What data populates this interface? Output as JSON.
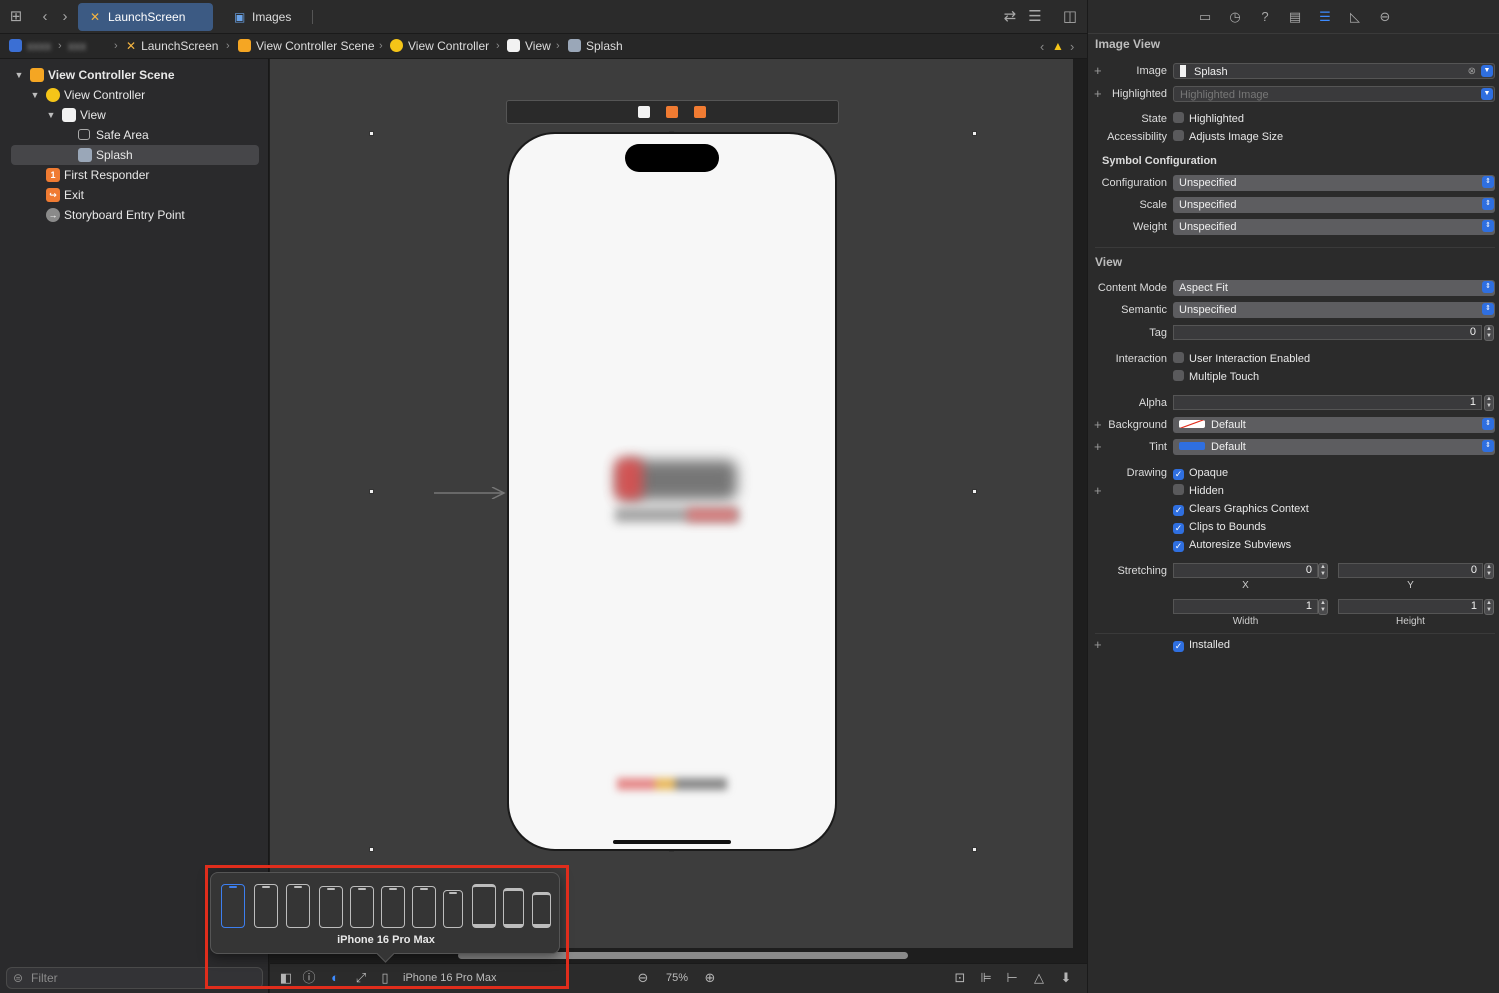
{
  "tabs": [
    {
      "label": "LaunchScreen",
      "active": true,
      "icon": "storyboard-icon"
    },
    {
      "label": "Images",
      "active": false,
      "icon": "asset-catalog-icon"
    }
  ],
  "breadcrumb": {
    "project": "xxxx",
    "group": "xxx",
    "file": "LaunchScreen",
    "scene": "View Controller Scene",
    "controller": "View Controller",
    "view": "View",
    "item": "Splash"
  },
  "navigator": {
    "items": [
      {
        "label": "View Controller Scene",
        "icon": "scene-icon"
      },
      {
        "label": "View Controller",
        "icon": "view-controller-icon"
      },
      {
        "label": "View",
        "icon": "view-icon"
      },
      {
        "label": "Safe Area",
        "icon": "safe-area-icon"
      },
      {
        "label": "Splash",
        "icon": "image-view-icon"
      },
      {
        "label": "First Responder",
        "icon": "first-responder-icon"
      },
      {
        "label": "Exit",
        "icon": "exit-icon"
      },
      {
        "label": "Storyboard Entry Point",
        "icon": "entry-point-icon"
      }
    ],
    "filter_placeholder": "Filter"
  },
  "bottombar": {
    "device": "iPhone 16 Pro Max",
    "zoom": "75%"
  },
  "device_popover": {
    "selected_device": "iPhone 16 Pro Max"
  },
  "inspector": {
    "image_view": {
      "title": "Image View",
      "image_label": "Image",
      "image_value": "Splash",
      "highlighted_label": "Highlighted",
      "highlighted_placeholder": "Highlighted Image",
      "state_label": "State",
      "state_option": "Highlighted",
      "accessibility_label": "Accessibility",
      "accessibility_option": "Adjusts Image Size",
      "symbol_title": "Symbol Configuration",
      "configuration_label": "Configuration",
      "configuration_value": "Unspecified",
      "scale_label": "Scale",
      "scale_value": "Unspecified",
      "weight_label": "Weight",
      "weight_value": "Unspecified"
    },
    "view": {
      "title": "View",
      "content_mode_label": "Content Mode",
      "content_mode_value": "Aspect Fit",
      "semantic_label": "Semantic",
      "semantic_value": "Unspecified",
      "tag_label": "Tag",
      "tag_value": "0",
      "interaction_label": "Interaction",
      "user_interaction": "User Interaction Enabled",
      "multiple_touch": "Multiple Touch",
      "alpha_label": "Alpha",
      "alpha_value": "1",
      "background_label": "Background",
      "background_value": "Default",
      "tint_label": "Tint",
      "tint_value": "Default",
      "drawing_label": "Drawing",
      "opaque": "Opaque",
      "hidden": "Hidden",
      "clears_context": "Clears Graphics Context",
      "clips_bounds": "Clips to Bounds",
      "autoresize": "Autoresize Subviews",
      "stretching_label": "Stretching",
      "stretch_x": "0",
      "stretch_y": "0",
      "stretch_w": "1",
      "stretch_h": "1",
      "x_caption": "X",
      "y_caption": "Y",
      "width_caption": "Width",
      "height_caption": "Height",
      "installed": "Installed"
    }
  },
  "colors": {
    "accent": "#2f6fe0",
    "active_tab": "#3c5a83",
    "highlight_box": "#e02d1c",
    "scene_icon": "#f5a623",
    "first_responder": "#f07b32"
  }
}
